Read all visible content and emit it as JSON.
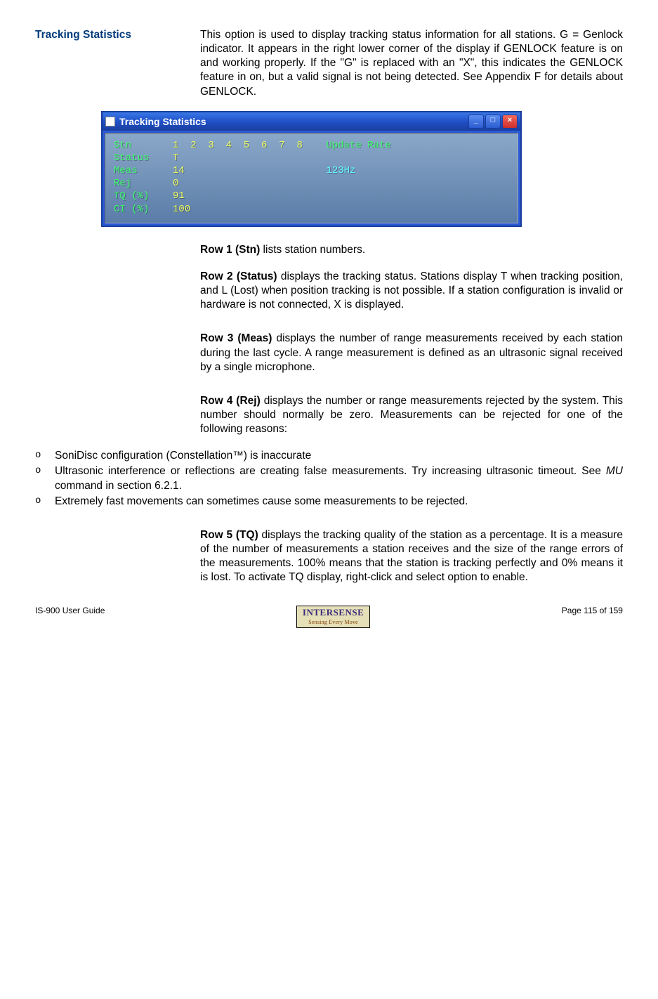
{
  "heading": "Tracking Statistics",
  "intro": "This option is used to display tracking status information for all stations.  G = Genlock indicator.  It appears in the right lower corner of the display if GENLOCK feature is on and working properly.  If the \"G\" is replaced with an \"X\", this indicates the GENLOCK feature in on, but a valid signal is not being detected.  See Appendix F for details about GENLOCK.",
  "window": {
    "title": "Tracking Statistics",
    "btn_min": "_",
    "btn_max": "□",
    "btn_close": "×",
    "rows": {
      "stn_label": "Stn       ",
      "stn_cols": "1  2  3  4  5  6  7  8    ",
      "update_label": "Update Rate",
      "status_label": "Status    ",
      "status_val": "T",
      "meas_label": "Meas      ",
      "meas_val": "14                        ",
      "update_val": "123Hz",
      "rej_label": "Rej       ",
      "rej_val": "0",
      "tq_label": "TQ (%)    ",
      "tq_val": "91",
      "ci_label": "CI (%)    ",
      "ci_val": "100"
    }
  },
  "row1": {
    "label": "Row 1 (Stn)",
    "text": " lists station numbers."
  },
  "row2": {
    "label": "Row 2 (Status)",
    "text": " displays the tracking status.  Stations display T when tracking position, and L (Lost) when position tracking is not possible.  If a station configuration is invalid or hardware is not connected, X is displayed."
  },
  "row3": {
    "label": "Row 3 (Meas)",
    "text": " displays the number of range measurements received by each station during the last cycle.  A range measurement is defined as an ultrasonic signal received by a single microphone."
  },
  "row4": {
    "label": "Row 4 (Rej)",
    "text": " displays the number or range measurements rejected by the system.  This number should normally be zero.  Measurements can be rejected for one of the following reasons:"
  },
  "bullets": {
    "b1": "SoniDisc configuration (Constellation™) is inaccurate",
    "b2a": "Ultrasonic interference or reflections are creating false measurements.  Try increasing ultrasonic timeout.  See ",
    "b2b_cmd": "MU",
    "b2c": " command in section 6.2.1.",
    "b3": "Extremely fast movements can sometimes cause some measurements to be rejected."
  },
  "row5": {
    "label": "Row 5 (TQ)",
    "text": " displays the tracking quality of the station as a percentage.  It is a measure of the number of measurements a station receives and the size of the range errors of the measurements.  100% means that the station is tracking perfectly and 0% means it is lost. To activate TQ display, right-click and select option to enable."
  },
  "footer": {
    "left": "IS-900 User Guide",
    "right": "Page 115 of 159",
    "logo_brand": "INTERSENSE",
    "logo_sub": "Sensing Every Move"
  },
  "marker": "o"
}
